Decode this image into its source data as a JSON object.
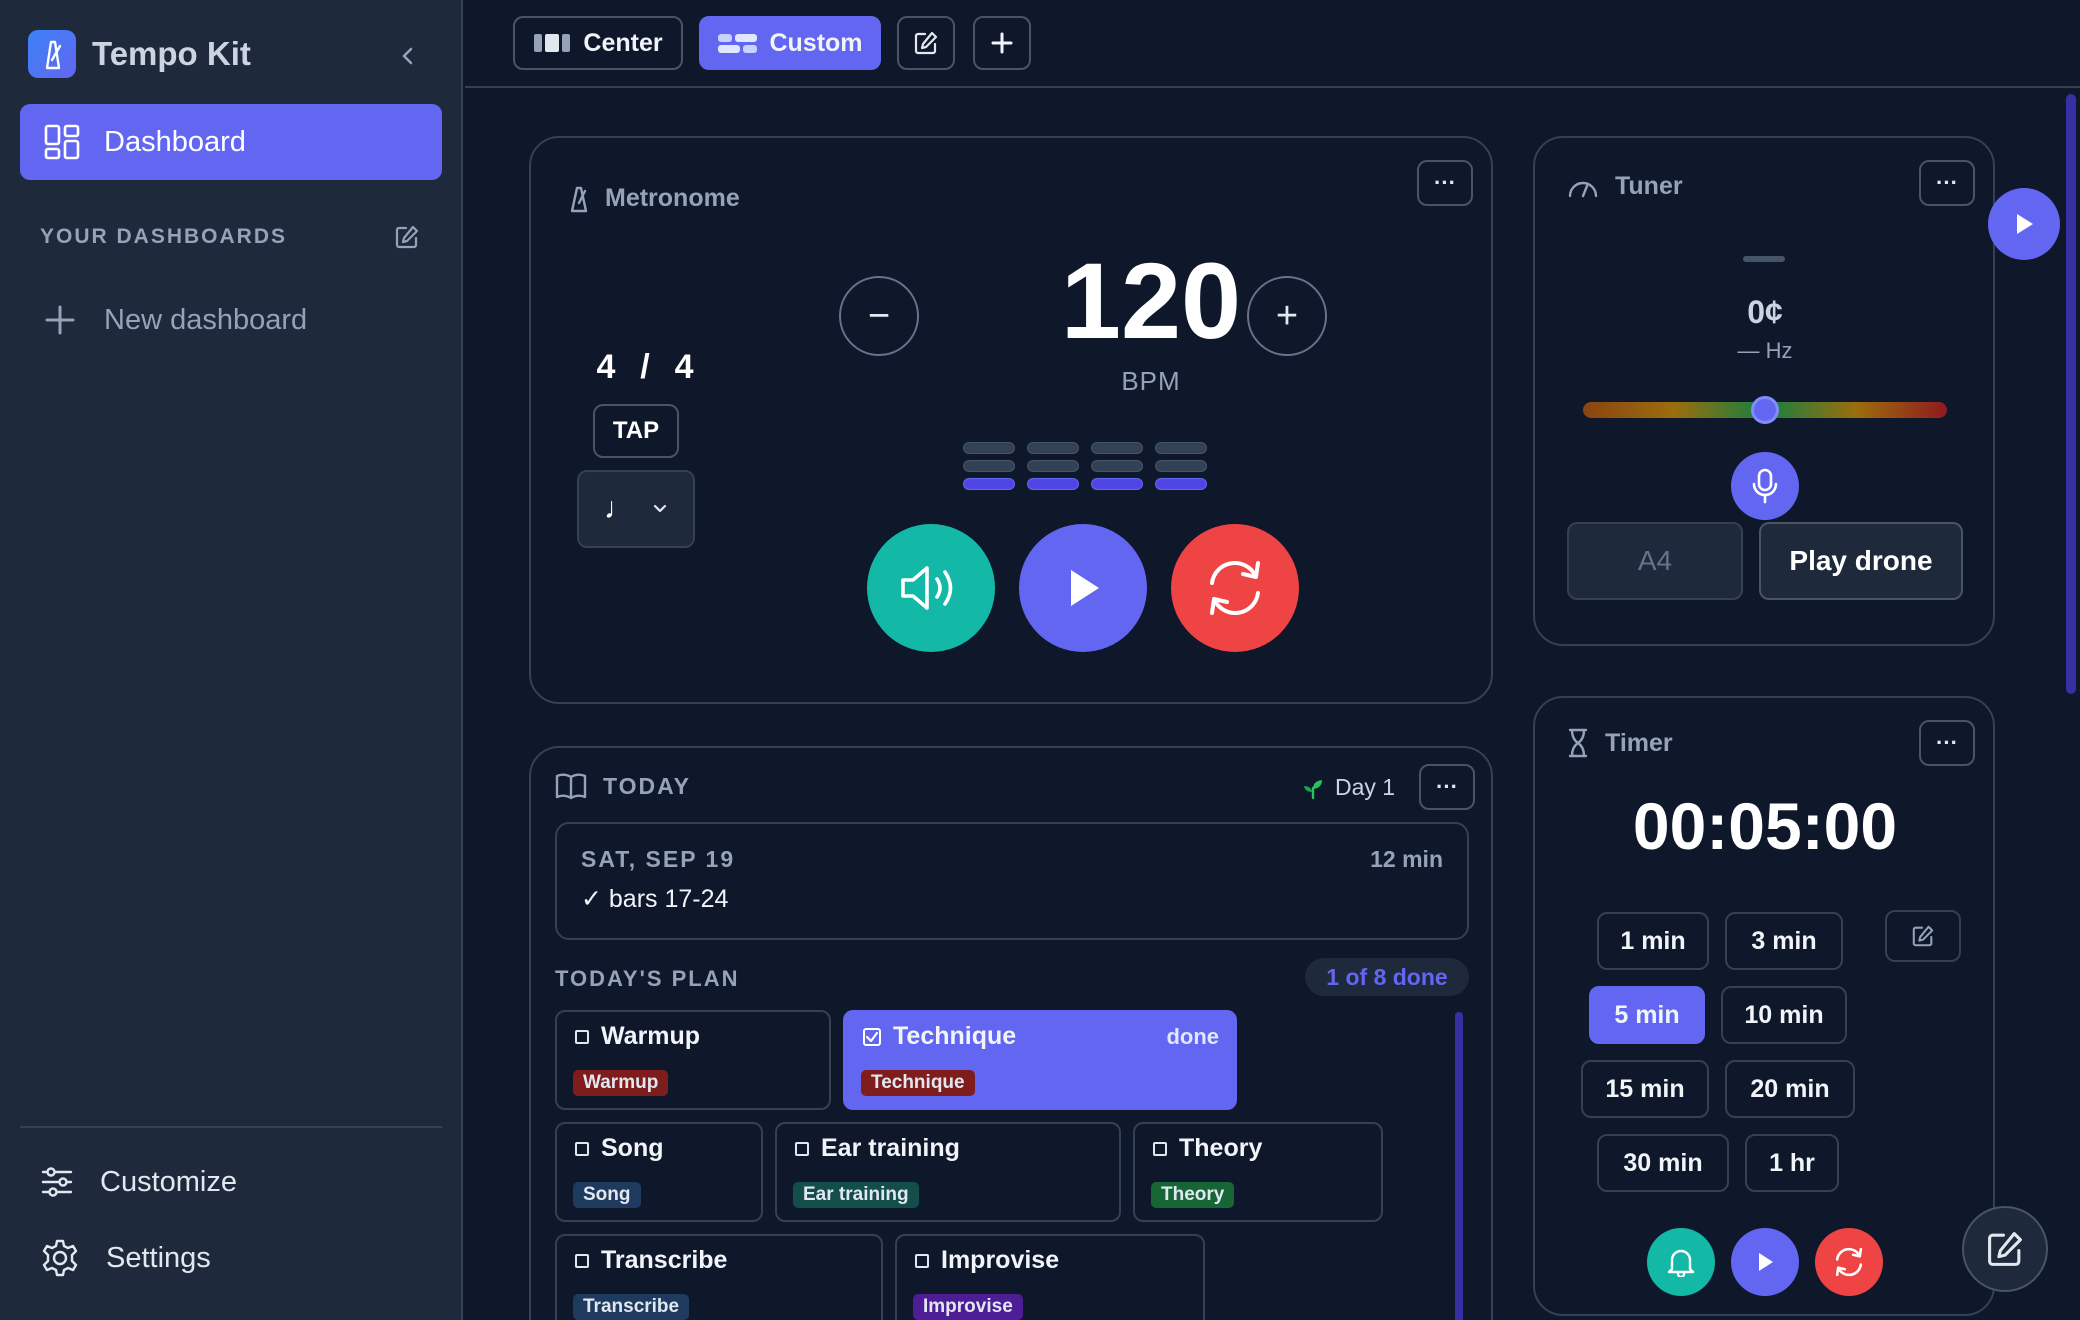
{
  "app": {
    "name": "Tempo Kit"
  },
  "sidebar": {
    "nav_dashboard": "Dashboard",
    "section_title": "YOUR DASHBOARDS",
    "new_dashboard": "New dashboard",
    "customize": "Customize",
    "settings": "Settings"
  },
  "topbar": {
    "center_label": "Center",
    "custom_label": "Custom"
  },
  "metronome": {
    "title": "Metronome",
    "time_signature": "4  /  4",
    "tap_label": "TAP",
    "note_value": "♩",
    "bpm": "120",
    "bpm_label": "BPM",
    "minus": "−",
    "plus": "+",
    "menu": "···"
  },
  "today": {
    "title": "TODAY",
    "day_label": "Day 1",
    "session_date": "SAT, SEP 19",
    "session_duration": "12 min",
    "session_note": "✓ bars 17-24",
    "plan_title": "TODAY'S PLAN",
    "plan_count": "1 of 8 done",
    "done_label": "done",
    "tasks": [
      {
        "name": "Warmup",
        "tag": "Warmup",
        "tag_color": "#7f1d1d",
        "done": false
      },
      {
        "name": "Technique",
        "tag": "Technique",
        "tag_color": "#7f1d1d",
        "done": true
      },
      {
        "name": "Song",
        "tag": "Song",
        "tag_color": "#1e3a5f",
        "done": false
      },
      {
        "name": "Ear training",
        "tag": "Ear training",
        "tag_color": "#134e4a",
        "done": false
      },
      {
        "name": "Theory",
        "tag": "Theory",
        "tag_color": "#166534",
        "done": false
      },
      {
        "name": "Transcribe",
        "tag": "Transcribe",
        "tag_color": "#1e3a5f",
        "done": false
      },
      {
        "name": "Improvise",
        "tag": "Improvise",
        "tag_color": "#4c1d95",
        "done": false
      }
    ]
  },
  "tuner": {
    "title": "Tuner",
    "cents": "0¢",
    "hz": "— Hz",
    "reference": "A4",
    "drone_label": "Play drone",
    "needle_position": 0.5
  },
  "timer": {
    "title": "Timer",
    "display": "00:05:00",
    "presets": [
      "1 min",
      "3 min",
      "5 min",
      "10 min",
      "15 min",
      "20 min",
      "30 min",
      "1 hr"
    ],
    "active_preset": "5 min"
  },
  "colors": {
    "accent": "#6366f1",
    "teal": "#14b8a6",
    "red": "#ef4444",
    "background": "#0f172a",
    "sidebar": "#1e293b"
  }
}
